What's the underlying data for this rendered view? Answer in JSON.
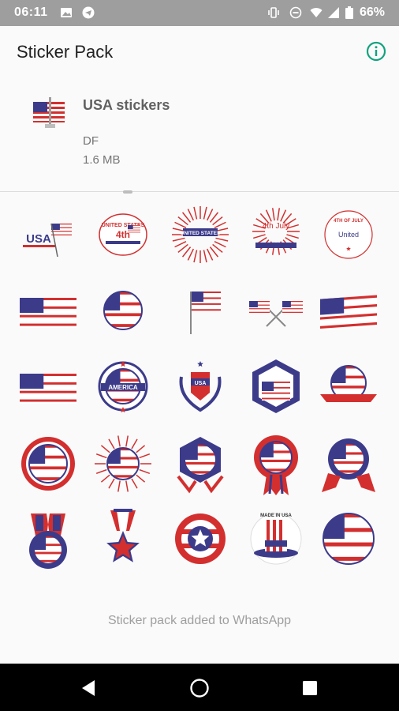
{
  "status_bar": {
    "time": "06:11",
    "battery_percent": "66%"
  },
  "app_bar": {
    "title": "Sticker Pack",
    "info_icon": "info-icon"
  },
  "pack": {
    "name": "USA stickers",
    "publisher": "DF",
    "size": "1.6 MB"
  },
  "stickers": [
    {
      "label": "USA",
      "icon": "usa-text-flag"
    },
    {
      "label": "UNITED STATES",
      "icon": "usa-independence-badge"
    },
    {
      "label": "UNITED STATES",
      "icon": "united-states-sunburst"
    },
    {
      "label": "4th July",
      "icon": "fourth-july-sunburst"
    },
    {
      "label": "4TH OF JULY",
      "icon": "independence-day-circle"
    },
    {
      "label": "",
      "icon": "flat-flag"
    },
    {
      "label": "",
      "icon": "round-flag"
    },
    {
      "label": "",
      "icon": "flag-on-pole"
    },
    {
      "label": "",
      "icon": "crossed-flags"
    },
    {
      "label": "",
      "icon": "waving-flag"
    },
    {
      "label": "",
      "icon": "flat-flag"
    },
    {
      "label": "AMERICA",
      "icon": "america-star-badge"
    },
    {
      "label": "USA",
      "icon": "usa-laurel-badge"
    },
    {
      "label": "",
      "icon": "star-hexagon-badge"
    },
    {
      "label": "",
      "icon": "round-flag-ribbon"
    },
    {
      "label": "",
      "icon": "round-flag-seal"
    },
    {
      "label": "",
      "icon": "flag-sunburst"
    },
    {
      "label": "",
      "icon": "flag-hexagon-ribbon"
    },
    {
      "label": "",
      "icon": "flag-rosette"
    },
    {
      "label": "",
      "icon": "flag-seal-ribbon"
    },
    {
      "label": "",
      "icon": "flag-medal"
    },
    {
      "label": "",
      "icon": "star-medal"
    },
    {
      "label": "",
      "icon": "star-shield"
    },
    {
      "label": "MADE IN USA",
      "icon": "uncle-sam-hat"
    },
    {
      "label": "",
      "icon": "round-flag-large"
    }
  ],
  "footer": {
    "message": "Sticker pack added to WhatsApp"
  },
  "nav": {
    "back": "back-icon",
    "home": "home-icon",
    "recents": "recents-icon"
  },
  "colors": {
    "flag_red": "#d32f2f",
    "flag_blue": "#3c3b8a",
    "accent": "#10a37f"
  }
}
